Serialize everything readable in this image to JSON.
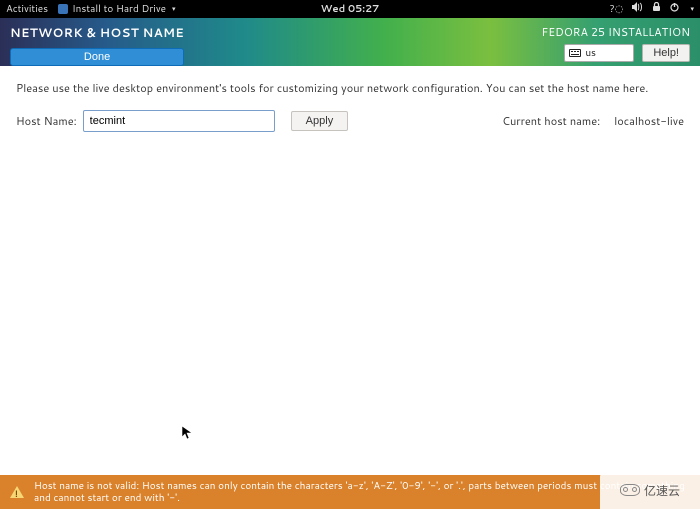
{
  "topbar": {
    "activities": "Activities",
    "app_title": "Install to Hard Drive",
    "clock": "Wed 05:27"
  },
  "header": {
    "title": "NETWORK & HOST NAME",
    "done_label": "Done",
    "installer_name": "FEDORA 25 INSTALLATION",
    "keyboard_layout": "us",
    "help_label": "Help!"
  },
  "main": {
    "instruction": "Please use the live desktop environment's tools for customizing your network configuration.  You can set the host name here.",
    "hostname_label": "Host Name:",
    "hostname_value": "tecmint",
    "apply_label": "Apply",
    "current_hostname_label": "Current host name:",
    "current_hostname_value": "localhost-live"
  },
  "warning": {
    "text": "Host name is not valid: Host names can only contain the characters 'a-z', 'A-Z', '0-9', '-', or '.', parts between periods must contain something and cannot start or end with '-'."
  },
  "watermark": {
    "text": "亿速云"
  }
}
